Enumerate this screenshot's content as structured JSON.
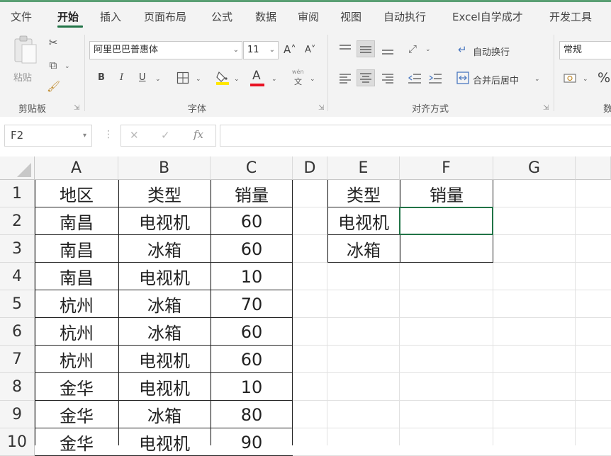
{
  "tabs": [
    "文件",
    "开始",
    "插入",
    "页面布局",
    "公式",
    "数据",
    "审阅",
    "视图",
    "自动执行",
    "Excel自学成才",
    "开发工具"
  ],
  "active_tab": "开始",
  "ribbon": {
    "paste_label": "粘贴",
    "font_name": "阿里巴巴普惠体",
    "font_size": "11",
    "grow_font": "A˄",
    "shrink_font": "A˅",
    "bold": "B",
    "italic": "I",
    "underline": "U",
    "font_color_glyph": "A",
    "phonetic_top": "wén",
    "phonetic_bottom": "文",
    "wrap_text": "自动换行",
    "merge_center": "合并后居中",
    "number_format": "常规",
    "percent": "%",
    "groups": {
      "clipboard": "剪贴板",
      "font": "字体",
      "alignment": "对齐方式",
      "number_partial": "数"
    }
  },
  "formula_bar": {
    "name_box": "F2",
    "cancel": "✕",
    "enter": "✓",
    "fx": "fx",
    "formula": ""
  },
  "sheet": {
    "columns": [
      "A",
      "B",
      "C",
      "D",
      "E",
      "F",
      "G"
    ],
    "rows": [
      "1",
      "2",
      "3",
      "4",
      "5",
      "6",
      "7",
      "8",
      "9",
      "10"
    ],
    "table1": [
      [
        "地区",
        "类型",
        "销量"
      ],
      [
        "南昌",
        "电视机",
        "60"
      ],
      [
        "南昌",
        "冰箱",
        "60"
      ],
      [
        "南昌",
        "电视机",
        "10"
      ],
      [
        "杭州",
        "冰箱",
        "70"
      ],
      [
        "杭州",
        "冰箱",
        "60"
      ],
      [
        "杭州",
        "电视机",
        "60"
      ],
      [
        "金华",
        "电视机",
        "10"
      ],
      [
        "金华",
        "冰箱",
        "80"
      ],
      [
        "金华",
        "电视机",
        "90"
      ]
    ],
    "table2": [
      [
        "类型",
        "销量"
      ],
      [
        "电视机",
        ""
      ],
      [
        "冰箱",
        ""
      ]
    ]
  }
}
